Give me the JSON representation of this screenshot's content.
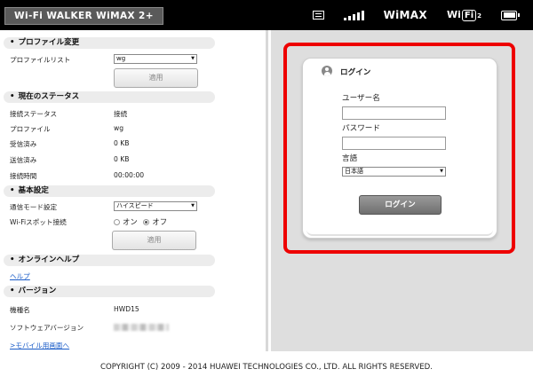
{
  "header": {
    "brand": "Wi-Fi WALKER WiMAX 2+",
    "network": "WiMAX",
    "wifi_prefix": "Wi",
    "wifi_box": "Fi",
    "wifi_sub": "2"
  },
  "profile": {
    "section_title": "プロファイル変更",
    "list_label": "プロファイルリスト",
    "selected": "wg",
    "apply_label": "適用"
  },
  "status": {
    "section_title": "現在のステータス",
    "rows": [
      {
        "label": "接続ステータス",
        "value": "接続"
      },
      {
        "label": "プロファイル",
        "value": "wg"
      },
      {
        "label": "受信済み",
        "value": "0 KB"
      },
      {
        "label": "送信済み",
        "value": "0 KB"
      },
      {
        "label": "接続時間",
        "value": "00:00:00"
      }
    ]
  },
  "basic": {
    "section_title": "基本設定",
    "mode_label": "通信モード設定",
    "mode_selected": "ハイスピード",
    "spot_label": "Wi-Fiスポット接続",
    "on_label": "オン",
    "off_label": "オフ",
    "apply_label": "適用"
  },
  "help": {
    "section_title": "オンラインヘルプ",
    "link": "ヘルプ"
  },
  "version": {
    "section_title": "バージョン",
    "model_label": "機種名",
    "model_value": "HWD15",
    "software_label": "ソフトウェアバージョン",
    "mobile_link": ">モバイル用画面へ"
  },
  "login": {
    "title": "ログイン",
    "username_label": "ユーザー名",
    "password_label": "パスワード",
    "language_label": "言語",
    "language_selected": "日本語",
    "button": "ログイン"
  },
  "footer": {
    "copyright": "COPYRIGHT (C) 2009 - 2014 HUAWEI TECHNOLOGIES CO., LTD. ALL RIGHTS RESERVED."
  },
  "colors": {
    "highlight": "#ee0000",
    "header_bg": "#000000",
    "link": "#1a5cc8"
  }
}
